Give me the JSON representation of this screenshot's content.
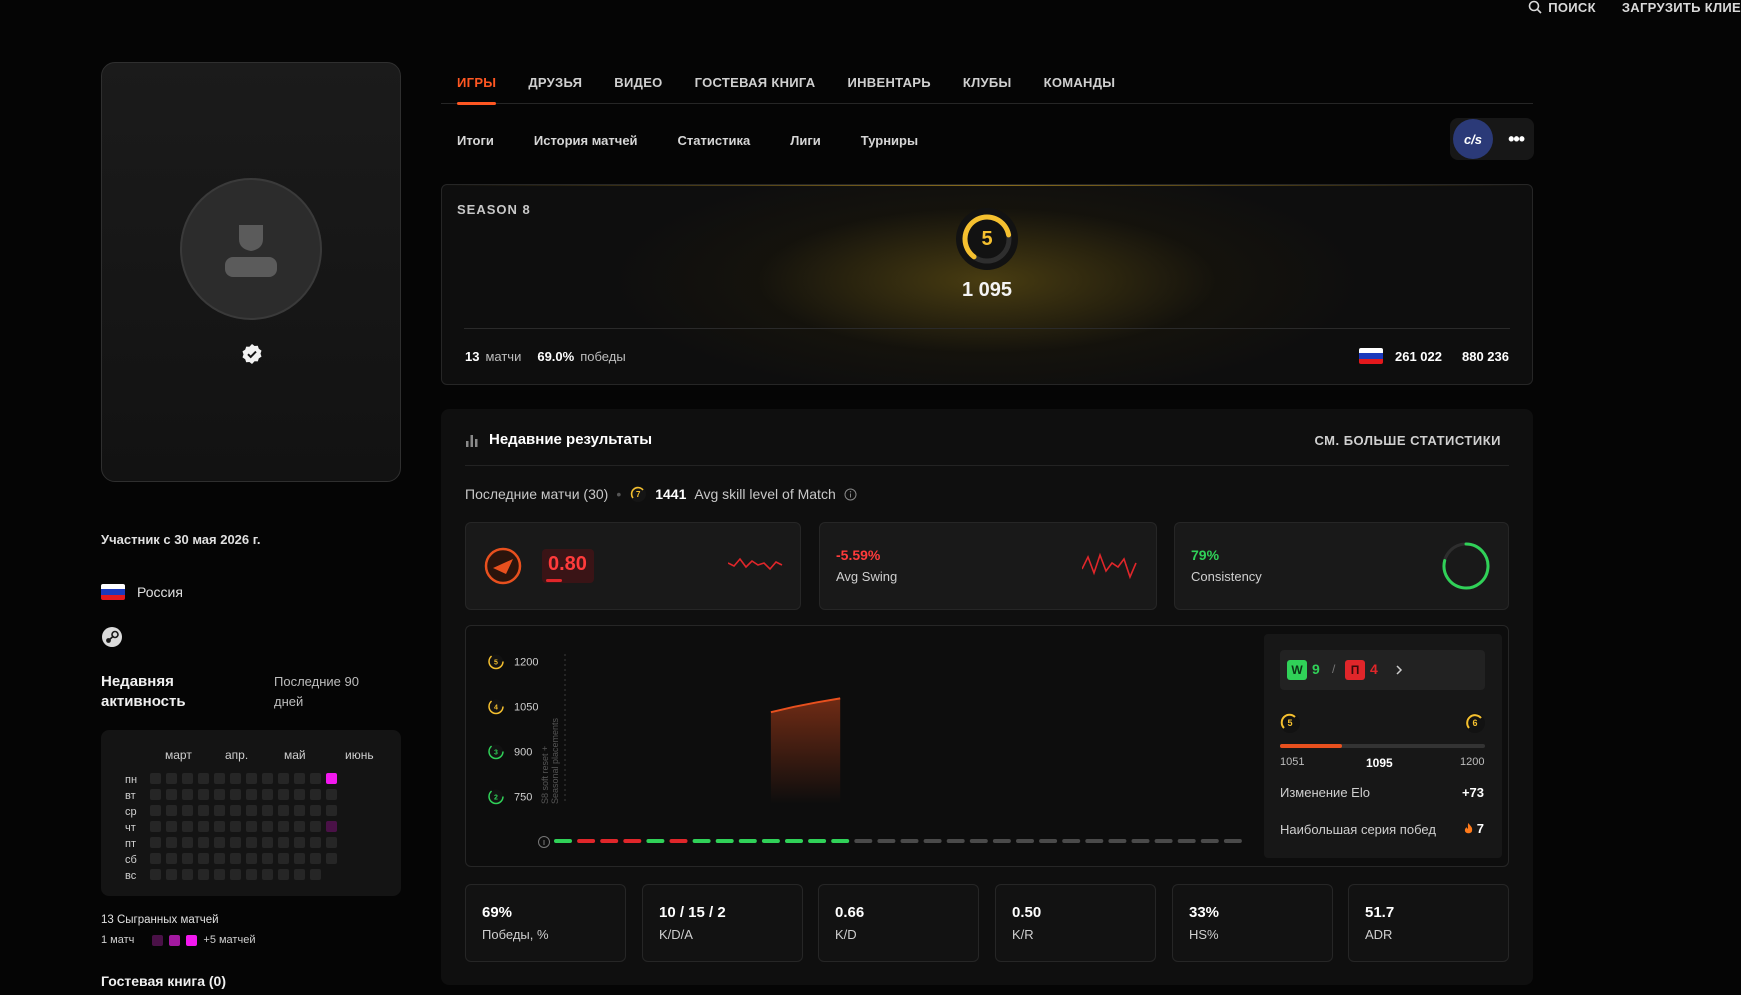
{
  "topbar": {
    "search": "ПОИСК",
    "upload": "ЗАГРУЗИТЬ КЛИЕ"
  },
  "profile": {
    "member_since": "Участник с 30 мая 2026 г.",
    "country": "Россия",
    "flag_colors": [
      "#ffffff",
      "#1c39bb",
      "#e4181c"
    ]
  },
  "activity": {
    "title": "Недавняя активность",
    "range": "Последние 90 дней",
    "months": [
      "март",
      "апр.",
      "май",
      "июнь"
    ],
    "days": [
      "пн",
      "вт",
      "ср",
      "чт",
      "пт",
      "сб",
      "вс"
    ],
    "played_text": "13 Сыгранных матчей",
    "legend_left": "1 матч",
    "legend_right": "+5 матчей",
    "colors": {
      "empty": "#262626",
      "low": "#4a1147",
      "mid": "#a319a0",
      "high": "#f218ee"
    }
  },
  "guestbook": "Гостевая книга (0)",
  "tabs": [
    "ИГРЫ",
    "ДРУЗЬЯ",
    "ВИДЕО",
    "ГОСТЕВАЯ КНИГА",
    "ИНВЕНТАРЬ",
    "КЛУБЫ",
    "КОМАНДЫ"
  ],
  "subtabs": [
    "Итоги",
    "История матчей",
    "Статистика",
    "Лиги",
    "Турниры"
  ],
  "game_badge": "c/s",
  "season": {
    "label": "SEASON 8",
    "level": "5",
    "elo": "1 095",
    "matches": "13",
    "matches_label": "матчи",
    "winrate": "69.0%",
    "winrate_label": "победы",
    "country_rank": "261 022",
    "world_rank": "880 236",
    "accent": "#f5c02f"
  },
  "results": {
    "title": "Недавние результаты",
    "more": "СМ. БОЛЬШЕ СТАТИСТИКИ",
    "last_matches": "Последние матчи (30)",
    "avg_level": "7",
    "avg_elo": "1441",
    "avg_label": "Avg skill level of Match",
    "kpi": {
      "rating": "0.80",
      "swing": "-5.59%",
      "swing_label": "Avg Swing",
      "consistency": "79%",
      "consistency_label": "Consistency",
      "consistency_fraction": 0.79
    },
    "chart": {
      "y_levels": [
        "5",
        "4",
        "3",
        "2"
      ],
      "y_labels": [
        "1200",
        "1050",
        "900",
        "750"
      ],
      "annotation": "S8 soft reset +",
      "annotation2": "Seasonal placements",
      "results": [
        "W",
        "L",
        "L",
        "L",
        "W",
        "L",
        "W",
        "W",
        "W",
        "W",
        "W",
        "W",
        "W",
        "-",
        "-",
        "-",
        "-",
        "-",
        "-",
        "-",
        "-",
        "-",
        "-",
        "-",
        "-",
        "-",
        "-",
        "-",
        "-",
        "-"
      ],
      "elo_points": [
        {
          "m": 10,
          "elo": 1031
        },
        {
          "m": 11,
          "elo": 1049
        },
        {
          "m": 12,
          "elo": 1064
        },
        {
          "m": 13,
          "elo": 1077
        }
      ],
      "y_range": [
        725,
        1225
      ],
      "colors": {
        "win": "#30d158",
        "loss": "#e0262a",
        "none": "#4a4a4a",
        "line": "#e8501e"
      }
    },
    "panel": {
      "w_letter": "W",
      "wins": "9",
      "sep": "/",
      "l_letter": "П",
      "losses": "4",
      "level_from": "5",
      "level_to": "6",
      "elo_min": "1051",
      "elo_cur": "1095",
      "elo_max": "1200",
      "progress_fraction": 0.3,
      "elo_change_label": "Изменение Elo",
      "elo_change": "+73",
      "streak_label": "Наибольшая серия побед",
      "streak": "7"
    },
    "stats": [
      {
        "value": "69%",
        "label": "Победы, %"
      },
      {
        "value": "10 / 15 / 2",
        "label": "K/D/A"
      },
      {
        "value": "0.66",
        "label": "K/D"
      },
      {
        "value": "0.50",
        "label": "K/R"
      },
      {
        "value": "33%",
        "label": "HS%"
      },
      {
        "value": "51.7",
        "label": "ADR"
      }
    ]
  }
}
